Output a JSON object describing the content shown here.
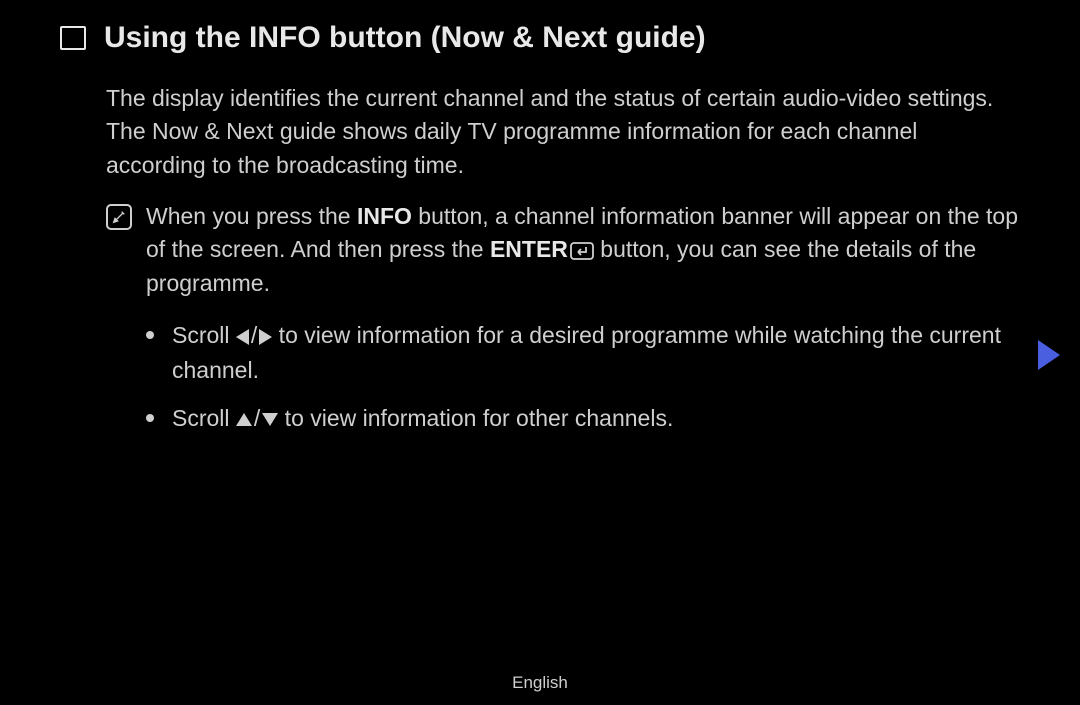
{
  "title": "Using the INFO button (Now & Next guide)",
  "intro": {
    "p1": "The display identifies the current channel and the status of certain audio-video settings.",
    "p2": "The Now & Next guide shows daily TV programme information for each channel according to the broadcasting time."
  },
  "note": {
    "pre1": "When you press the ",
    "info_label": "INFO",
    "mid1": " button, a channel information banner will appear on the top of the screen. And then press the ",
    "enter_label": "ENTER",
    "post1": " button, you can see the details of the programme."
  },
  "bullets": {
    "b1_pre": "Scroll ",
    "b1_post": " to view information for a desired programme while watching the current channel.",
    "b2_pre": "Scroll ",
    "b2_post": " to view information for other channels."
  },
  "footer": {
    "language": "English"
  }
}
